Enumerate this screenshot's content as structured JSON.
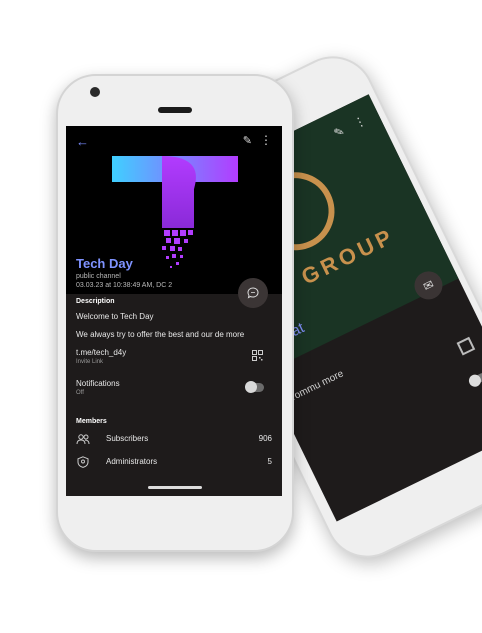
{
  "back_phone": {
    "group_text": "AY GROUP",
    "chat_text": "yChat",
    "snippet": "rommu  more"
  },
  "front_phone": {
    "channel_title": "Tech Day",
    "channel_type": "public channel",
    "channel_timestamp": "03.03.23 at 10:38:49 AM, DC 2",
    "description": {
      "header": "Description",
      "line1": "Welcome to Tech Day",
      "line2": "We always try to offer the best and our de  more"
    },
    "invite": {
      "link": "t.me/tech_d4y",
      "label": "Invite Link"
    },
    "notifications": {
      "label": "Notifications",
      "state": "Off"
    },
    "members": {
      "header": "Members",
      "subscribers_label": "Subscribers",
      "subscribers_count": "906",
      "admins_label": "Administrators",
      "admins_count": "5"
    },
    "accent_color": "#7f93ff",
    "logo_gradient": [
      "#3fd0ff",
      "#b23cff"
    ]
  }
}
